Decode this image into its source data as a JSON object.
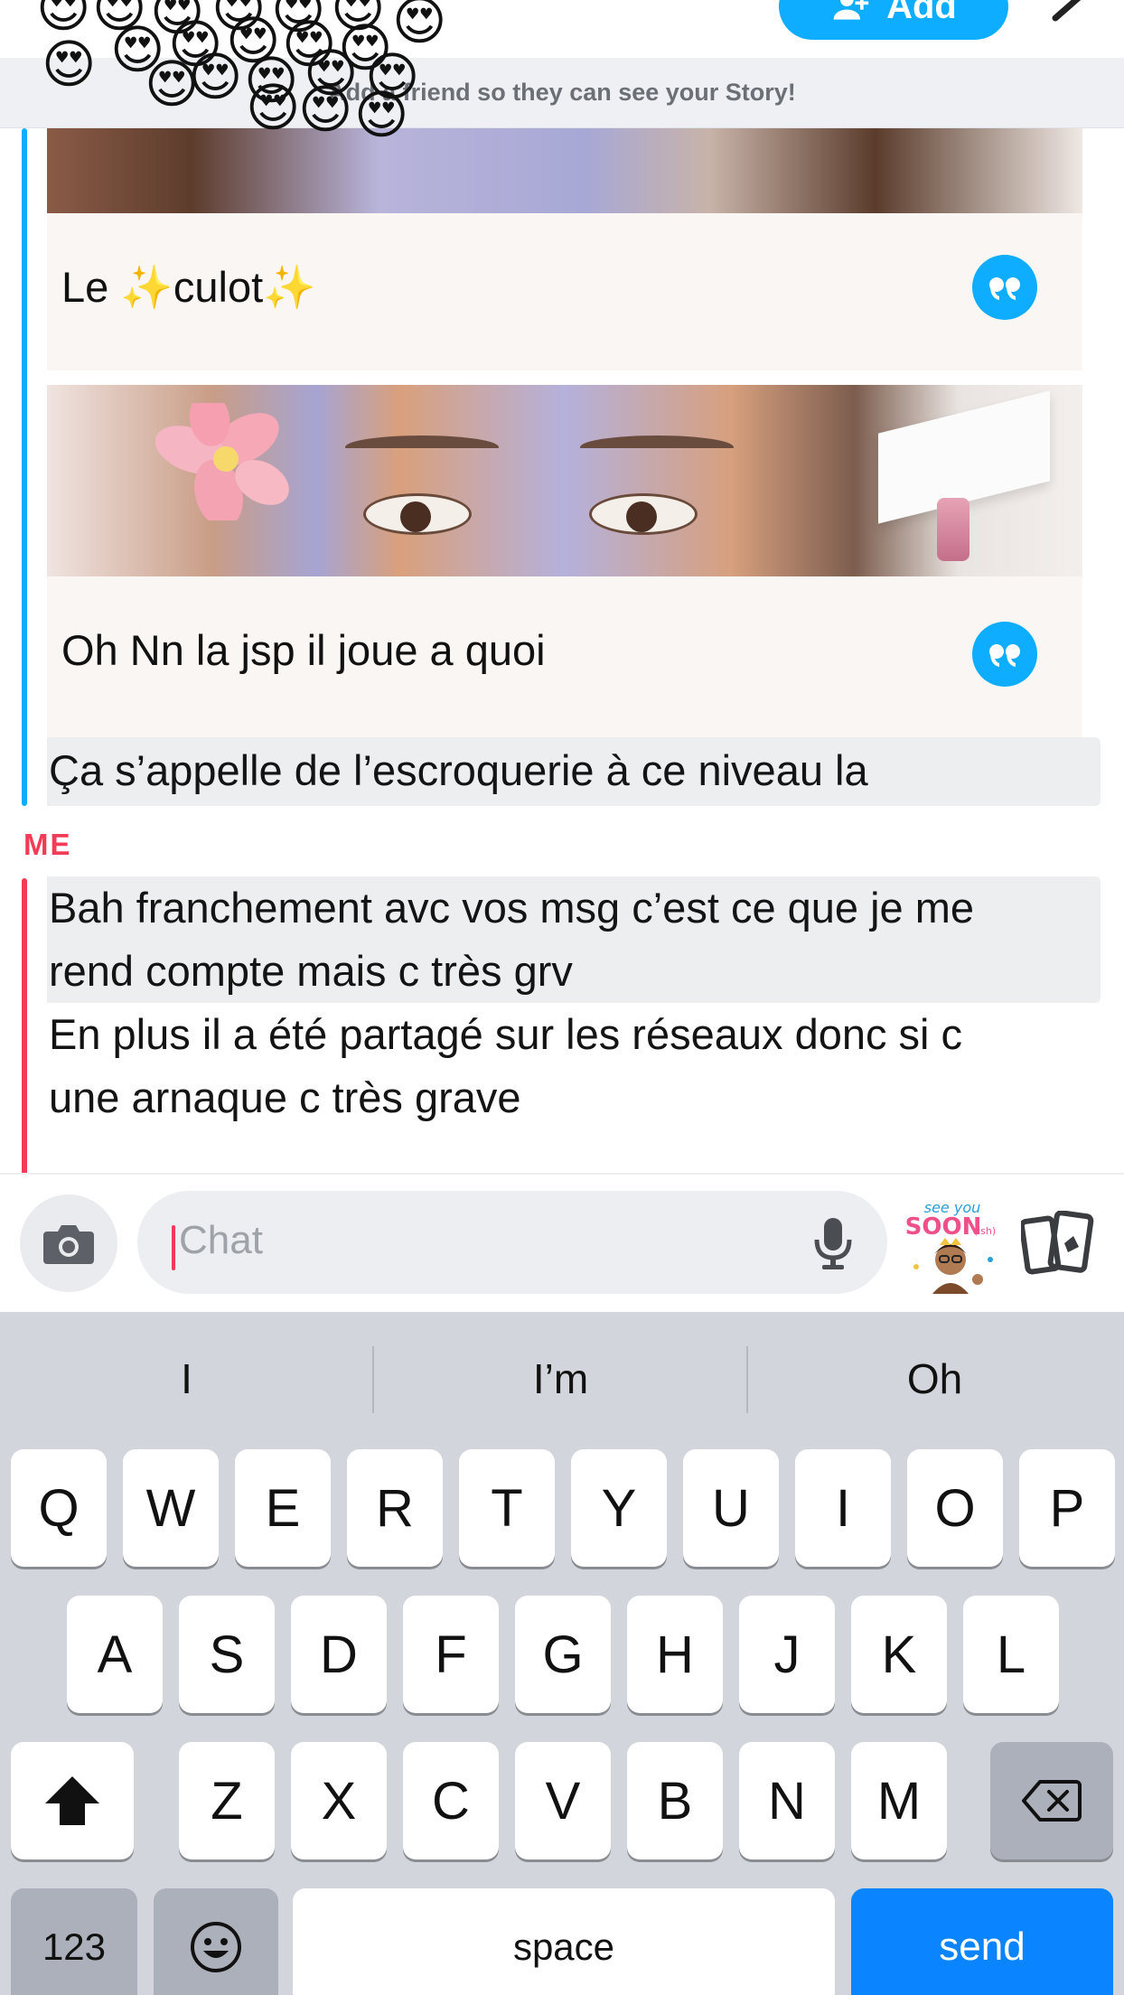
{
  "header": {
    "add_label": "Add",
    "story_banner": "Add a friend so they can see your Story!",
    "emoji": "😍"
  },
  "messages": {
    "quote_1_caption": "Le ✨culot✨",
    "quote_2_caption": "Oh Nn la jsp il joue a quoi",
    "friend_message": "Ça s’appelle de l’escroquerie à ce niveau la",
    "me_label": "ME",
    "me_message_1_line1": "Bah franchement avc vos msg c’est ce que je me",
    "me_message_1_line2": "rend compte mais c très grv",
    "me_message_2_line1": "En plus il a été partagé sur les réseaux donc si c",
    "me_message_2_line2": "une arnaque c très grave"
  },
  "input": {
    "placeholder": "Chat",
    "sticker_text": "see you soon (ish)"
  },
  "keyboard": {
    "suggestions": [
      "I",
      "I’m",
      "Oh"
    ],
    "row1": [
      "Q",
      "W",
      "E",
      "R",
      "T",
      "Y",
      "U",
      "I",
      "O",
      "P"
    ],
    "row2": [
      "A",
      "S",
      "D",
      "F",
      "G",
      "H",
      "J",
      "K",
      "L"
    ],
    "row3": [
      "Z",
      "X",
      "C",
      "V",
      "B",
      "N",
      "M"
    ],
    "numbers_label": "123",
    "space_label": "space",
    "send_label": "send"
  },
  "colors": {
    "snap_blue": "#0eadff",
    "me_red": "#f23c57",
    "send_blue": "#0a84ff",
    "keyboard_bg": "#d2d5db"
  },
  "icons": [
    "add-friend-icon",
    "chevron-icon",
    "quote-reply-icon",
    "camera-icon",
    "microphone-icon",
    "bitmoji-sticker-icon",
    "cards-icon",
    "shift-icon",
    "backspace-icon",
    "emoji-icon"
  ]
}
